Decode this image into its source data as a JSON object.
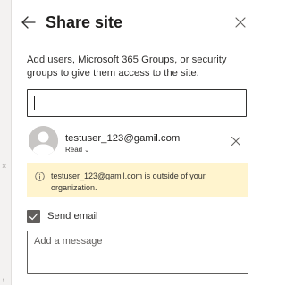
{
  "panel": {
    "title": "Share site",
    "description": "Add users, Microsoft 365 Groups, or security groups to give them access to the site."
  },
  "search": {
    "value": "",
    "placeholder": ""
  },
  "user": {
    "email": "testuser_123@gamil.com",
    "permission": "Read",
    "permission_chevron": "⌄"
  },
  "warning": {
    "message": "testuser_123@gamil.com is outside of your organization."
  },
  "send_email": {
    "label": "Send email",
    "checked": true
  },
  "message": {
    "placeholder": "Add a message",
    "value": ""
  },
  "background": {
    "edge_mark_1": "×",
    "edge_mark_2": "t"
  },
  "icons": {
    "back": "arrow-left-icon",
    "close": "close-icon",
    "avatar": "person-icon",
    "remove": "close-icon",
    "info": "info-icon",
    "check": "checkmark-icon"
  },
  "colors": {
    "warning_background": "#fff4ce",
    "checkbox_fill": "#615e5c",
    "input_border": "#323130"
  }
}
